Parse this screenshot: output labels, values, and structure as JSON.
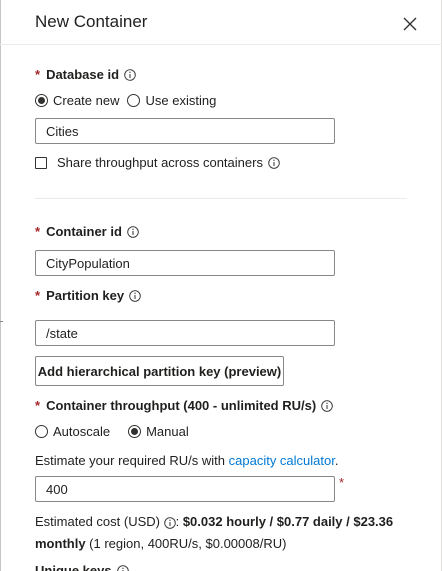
{
  "panel": {
    "title": "New Container",
    "close_icon": "close-icon"
  },
  "database": {
    "label": "Database id",
    "required_mark": "*",
    "options": [
      {
        "label": "Create new",
        "selected": true
      },
      {
        "label": "Use existing",
        "selected": false
      }
    ],
    "value": "Cities",
    "share_throughput_label": "Share throughput across containers",
    "share_throughput_checked": false
  },
  "container": {
    "label": "Container id",
    "required_mark": "*",
    "value": "CityPopulation"
  },
  "partition": {
    "label": "Partition key",
    "required_mark": "*",
    "value": "/state",
    "add_hierarchical_label": "Add hierarchical partition key (preview)"
  },
  "throughput": {
    "label": "Container throughput (400 - unlimited RU/s)",
    "required_mark": "*",
    "options": [
      {
        "label": "Autoscale",
        "selected": false
      },
      {
        "label": "Manual",
        "selected": true
      }
    ],
    "estimate_text": "Estimate your required RU/s with ",
    "estimate_link": "capacity calculator",
    "estimate_end": ".",
    "value": "400",
    "field_required_mark": "*"
  },
  "cost": {
    "prefix": "Estimated cost (USD) ",
    "colon": ": ",
    "bold_line1": "$0.032 hourly / $0.77 daily / $23.36",
    "bold_line2": "monthly",
    "detail": " (1 region, 400RU/s, $0.00008/RU)"
  },
  "unique_keys": {
    "label": "Unique keys"
  },
  "colors": {
    "required": "#a4262c",
    "link": "#0078d4",
    "border": "#8a8886"
  }
}
